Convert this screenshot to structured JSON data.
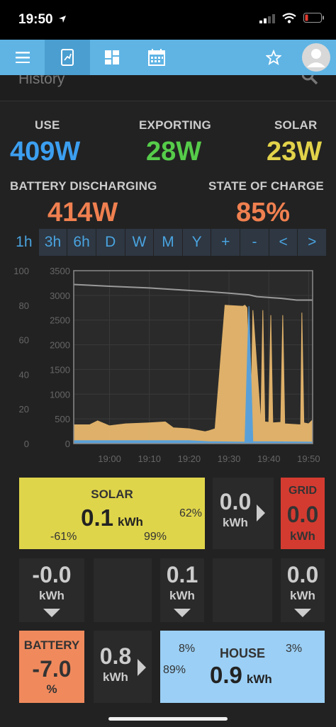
{
  "status": {
    "time": "19:50"
  },
  "nav": {
    "items": [
      "menu-icon",
      "tablet-icon",
      "dashboard-icon",
      "calendar-icon",
      "star-icon",
      "avatar"
    ]
  },
  "header": {
    "title": "History"
  },
  "stats": {
    "use_label": "USE",
    "use_value": "409W",
    "export_label": "EXPORTING",
    "export_value": "28W",
    "solar_label": "SOLAR",
    "solar_value": "23W",
    "battery_label": "BATTERY DISCHARGING",
    "battery_value": "414W",
    "soc_label": "STATE OF CHARGE",
    "soc_value": "85%"
  },
  "ranges": [
    "1h",
    "3h",
    "6h",
    "D",
    "W",
    "M",
    "Y",
    "+",
    "-",
    "<",
    ">"
  ],
  "colors": {
    "use": "#3c9ff0",
    "export": "#56cc4a",
    "solar": "#e2d24a",
    "battery": "#f08050",
    "grid": "#d43b30",
    "house": "#9bcff5",
    "solar_tile": "#dfd54a",
    "battery_tile": "#f08a5d"
  },
  "chart_data": {
    "type": "area",
    "x_ticks": [
      "19:00",
      "19:10",
      "19:20",
      "19:30",
      "19:40",
      "19:50"
    ],
    "y_left_ticks": [
      "0",
      "20",
      "40",
      "60",
      "80",
      "100"
    ],
    "y_right_ticks": [
      "0",
      "500",
      "1000",
      "1500",
      "2000",
      "2500",
      "3000",
      "3500"
    ],
    "ylim_right": [
      0,
      3500
    ],
    "ylim_left": [
      0,
      100
    ],
    "x_range_min": [
      -9,
      51
    ],
    "series": [
      {
        "name": "",
        "color": "#e8b86d",
        "x": [
          -9,
          -5,
          -3,
          0,
          4,
          10,
          14,
          16,
          20,
          24,
          25,
          26.5,
          29,
          33.5,
          34,
          34.5,
          35.5,
          36,
          38,
          38.5,
          39,
          40,
          40.5,
          41,
          43,
          43.5,
          44,
          48,
          48.3,
          48.8,
          50,
          51
        ],
        "y": [
          380,
          380,
          460,
          360,
          400,
          420,
          440,
          320,
          300,
          240,
          260,
          300,
          2800,
          2780,
          2800,
          2750,
          600,
          2700,
          420,
          2700,
          440,
          430,
          2600,
          420,
          430,
          2600,
          400,
          380,
          2650,
          420,
          400,
          480
        ]
      },
      {
        "name": "",
        "color": "#5aa0d8",
        "x": [
          -9,
          20,
          25,
          34,
          35,
          36,
          51
        ],
        "y": [
          60,
          60,
          40,
          30,
          2780,
          40,
          30
        ]
      },
      {
        "name": "",
        "color": "#9a9a9a",
        "axis": "left",
        "x": [
          -9,
          0,
          10,
          17,
          24,
          30,
          35,
          37,
          43,
          47,
          51
        ],
        "y": [
          92,
          91,
          90,
          89,
          88,
          87,
          86,
          85,
          84,
          83,
          83
        ]
      }
    ]
  },
  "energy": {
    "solar_label": "SOLAR",
    "solar_value": "0.1",
    "solar_unit": "kWh",
    "solar_pct_right": "62%",
    "solar_pct_left": "-61%",
    "solar_pct_bottom": "99%",
    "export_value": "0.0",
    "export_unit": "kWh",
    "grid_label": "GRID",
    "grid_value": "0.0",
    "grid_unit": "kWh",
    "r2_a_value": "-0.0",
    "r2_a_unit": "kWh",
    "r2_b_value": "0.1",
    "r2_b_unit": "kWh",
    "r2_c_value": "0.0",
    "r2_c_unit": "kWh",
    "battery_label": "BATTERY",
    "battery_value": "-7.0",
    "battery_unit": "%",
    "batt_flow_value": "0.8",
    "batt_flow_unit": "kWh",
    "house_label": "HOUSE",
    "house_value": "0.9",
    "house_unit": "kWh",
    "house_pct_tl": "8%",
    "house_pct_tr": "3%",
    "house_pct_l": "89%"
  }
}
